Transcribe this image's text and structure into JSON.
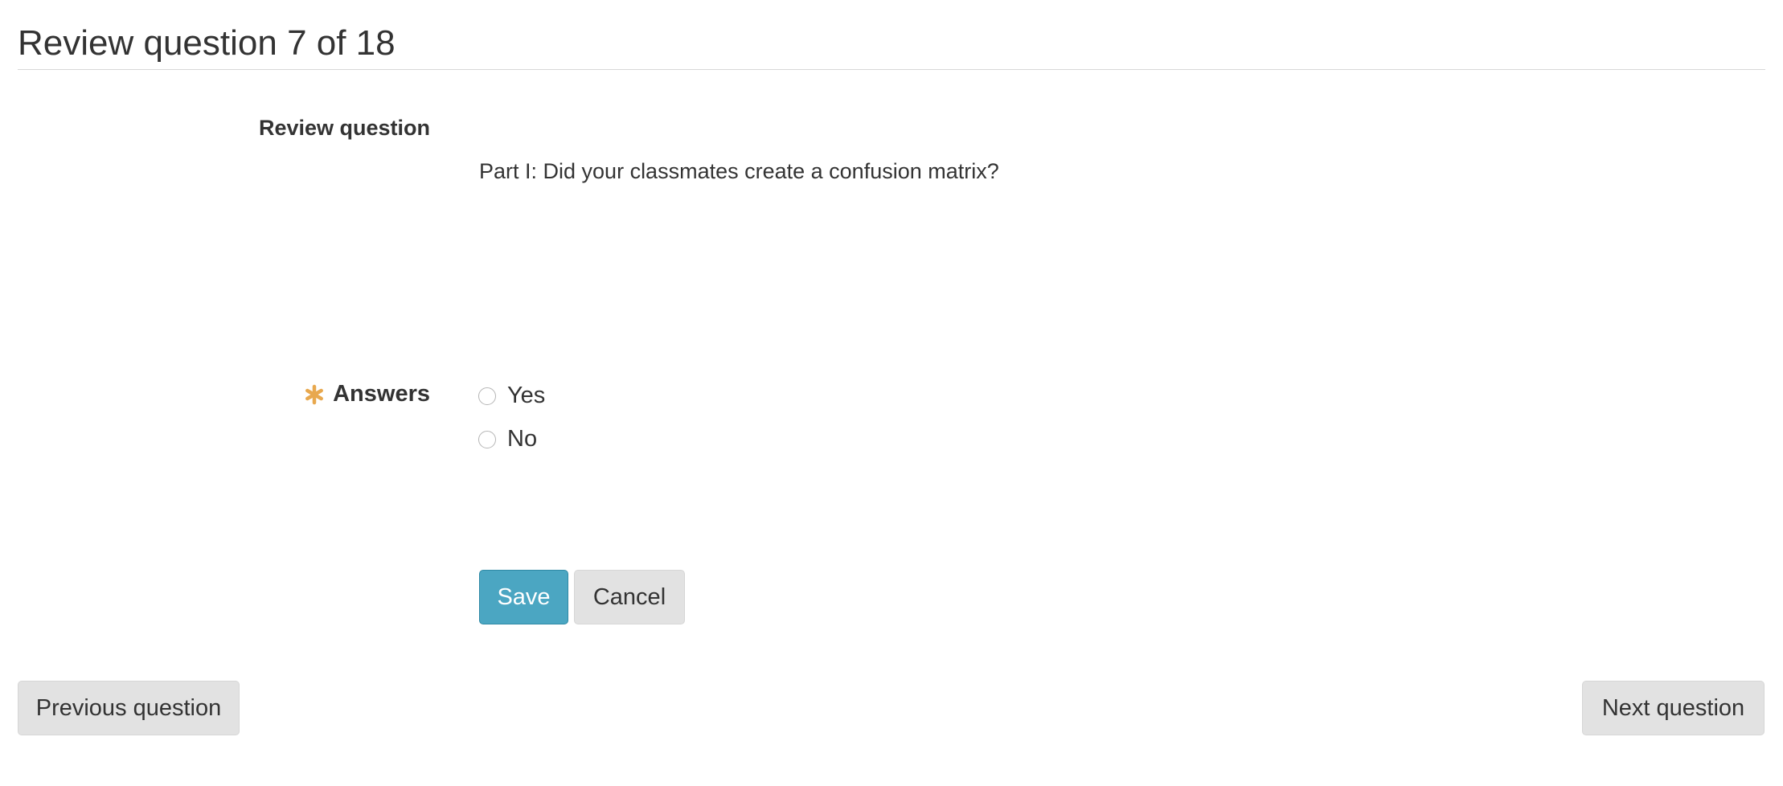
{
  "page": {
    "title": "Review question 7 of 18"
  },
  "form": {
    "section_label": "Review question",
    "question_text": "Part I: Did your classmates create a confusion matrix?",
    "answers_label": "Answers",
    "required_icon": "asterisk-icon",
    "required_color": "#e8a84e",
    "options": [
      {
        "label": "Yes",
        "selected": false
      },
      {
        "label": "No",
        "selected": false
      }
    ],
    "save_label": "Save",
    "cancel_label": "Cancel",
    "save_color": "#4ba6c2"
  },
  "navigation": {
    "previous_label": "Previous question",
    "next_label": "Next question"
  }
}
